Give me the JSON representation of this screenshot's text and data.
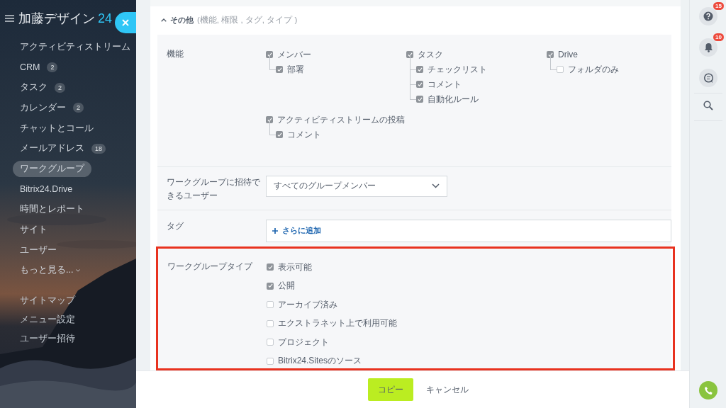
{
  "sidebar": {
    "logo": "加藤デザイン",
    "logo_suffix": "24",
    "items": [
      {
        "label": "アクティビティストリーム",
        "selected": false
      },
      {
        "label": "CRM",
        "count": "2",
        "selected": false
      },
      {
        "label": "タスク",
        "count": "2",
        "selected": false
      },
      {
        "label": "カレンダー",
        "count": "2",
        "selected": false
      },
      {
        "label": "チャットとコール",
        "selected": false
      },
      {
        "label": "メールアドレス",
        "count": "18",
        "selected": false
      },
      {
        "label": "ワークグループ",
        "selected": true
      },
      {
        "label": "Bitrix24.Drive",
        "selected": false
      },
      {
        "label": "時間とレポート",
        "selected": false
      },
      {
        "label": "サイト",
        "selected": false
      },
      {
        "label": "ユーザー",
        "selected": false
      },
      {
        "label": "もっと見る...",
        "selected": false,
        "kind": "expander"
      }
    ],
    "links": [
      "サイトマップ",
      "メニュー設定",
      "ユーザー招待"
    ]
  },
  "section": {
    "title": "その他",
    "subtitle": "(機能, 権限 , タグ, タイプ )",
    "expanded": true
  },
  "features": {
    "label": "機能",
    "groups": [
      {
        "label": "メンバー",
        "checked": true,
        "children": [
          {
            "label": "部署",
            "checked": true
          }
        ]
      },
      {
        "label": "タスク",
        "checked": true,
        "children": [
          {
            "label": "チェックリスト",
            "checked": true
          },
          {
            "label": "コメント",
            "checked": true
          },
          {
            "label": "自動化ルール",
            "checked": true
          }
        ]
      },
      {
        "label": "Drive",
        "checked": true,
        "children": [
          {
            "label": "フォルダのみ",
            "checked": false
          }
        ]
      },
      {
        "label": "アクティビティストリームの投稿",
        "checked": true,
        "children": [
          {
            "label": "コメント",
            "checked": true
          }
        ]
      }
    ]
  },
  "invite": {
    "label": "ワークグループに招待できるユーザー",
    "value": "すべてのグループメンバー"
  },
  "tags": {
    "label": "タグ",
    "add": "さらに追加"
  },
  "types": {
    "label": "ワークグループタイプ",
    "highlighted": true,
    "options": [
      {
        "label": "表示可能",
        "checked": true
      },
      {
        "label": "公開",
        "checked": true
      },
      {
        "label": "アーカイブ済み",
        "checked": false
      },
      {
        "label": "エクストラネット上で利用可能",
        "checked": false
      },
      {
        "label": "プロジェクト",
        "checked": false
      },
      {
        "label": "Bitrix24.Sitesのソース",
        "checked": false
      }
    ]
  },
  "footer": {
    "buttons": [
      {
        "label": "コピー",
        "kind": "primary"
      },
      {
        "label": "キャンセル",
        "kind": "link"
      }
    ]
  },
  "right_bar": {
    "help_count": "15",
    "notification_count": "10"
  }
}
